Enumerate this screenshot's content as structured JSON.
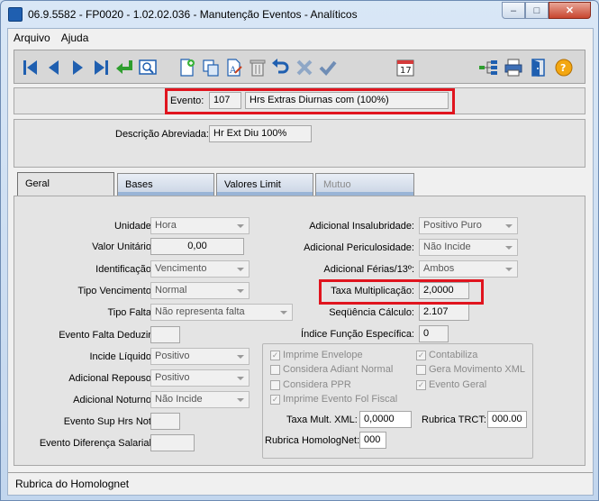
{
  "window": {
    "title": "06.9.5582 - FP0020 - 1.02.02.036 - Manutenção Eventos - Analíticos",
    "minimize": "–",
    "maximize": "□",
    "close": "✕"
  },
  "menu": {
    "items": [
      {
        "label": "Arquivo"
      },
      {
        "label": "Ajuda"
      }
    ]
  },
  "toolbar": {
    "icons": [
      "first-record-icon",
      "previous-record-icon",
      "next-record-icon",
      "last-record-icon",
      "return-icon",
      "search-icon",
      "new-document-icon",
      "copy-icon",
      "rename-icon",
      "delete-icon",
      "undo-icon",
      "cancel-icon",
      "confirm-icon",
      "calendar-icon",
      "tree-icon",
      "print-icon",
      "exit-door-icon",
      "help-icon"
    ],
    "calendar_day": "17",
    "help_label": "?"
  },
  "header": {
    "evento_label": "Evento:",
    "evento_code": "107",
    "evento_desc": "Hrs Extras Diurnas  com (100%)",
    "descricao_label": "Descrição Abreviada:",
    "descricao_value": "Hr Ext Diu 100%"
  },
  "tabs": [
    {
      "label": "Geral",
      "active": true
    },
    {
      "label": "Bases"
    },
    {
      "label": "Valores Limit"
    },
    {
      "label": "Mutuo",
      "disabled": true
    }
  ],
  "geral": {
    "left": {
      "unidade": {
        "label": "Unidade:",
        "value": "Hora"
      },
      "valor_unitario": {
        "label": "Valor Unitário:",
        "value": "0,00"
      },
      "identificacao": {
        "label": "Identificação:",
        "value": "Vencimento"
      },
      "tipo_vencimento": {
        "label": "Tipo Vencimento:",
        "value": "Normal"
      },
      "tipo_falta": {
        "label": "Tipo Falta:",
        "value": "Não representa falta"
      },
      "evento_falta": {
        "label": "Evento Falta Deduzir:",
        "value": ""
      },
      "incide_liquido": {
        "label": "Incide Líquido:",
        "value": "Positivo"
      },
      "adicional_repouso": {
        "label": "Adicional Repouso:",
        "value": "Positivo"
      },
      "adicional_noturno": {
        "label": "Adicional Noturno:",
        "value": "Não Incide"
      },
      "evento_sup": {
        "label": "Evento Sup Hrs Not:",
        "value": ""
      },
      "evento_diferenca": {
        "label": "Evento Diferença Salarial:",
        "value": ""
      }
    },
    "right": {
      "insalubridade": {
        "label": "Adicional Insalubridade:",
        "value": "Positivo Puro"
      },
      "periculosidade": {
        "label": "Adicional Periculosidade:",
        "value": "Não Incide"
      },
      "ferias": {
        "label": "Adicional Férias/13º:",
        "value": "Ambos"
      },
      "taxa_mult": {
        "label": "Taxa Multiplicação:",
        "value": "2,0000"
      },
      "sequencia": {
        "label": "Seqüência Cálculo:",
        "value": "2.107"
      },
      "indice": {
        "label": "Índice Função Específica:",
        "value": "0"
      }
    },
    "checks": {
      "imprime_envelope": {
        "label": "Imprime Envelope",
        "checked": true
      },
      "contabiliza": {
        "label": "Contabiliza",
        "checked": true
      },
      "considera_adiant": {
        "label": "Considera Adiant Normal",
        "checked": false
      },
      "gera_movimento": {
        "label": "Gera Movimento XML",
        "checked": false
      },
      "considera_ppr": {
        "label": "Considera PPR",
        "checked": false
      },
      "evento_geral": {
        "label": "Evento Geral",
        "checked": true
      },
      "imprime_fol": {
        "label": "Imprime Evento Fol Fiscal",
        "checked": true
      }
    },
    "group": {
      "taxa_xml_label": "Taxa Mult. XML:",
      "taxa_xml_value": "0,0000",
      "rubrica_trct_label": "Rubrica TRCT:",
      "rubrica_trct_value": "000.00",
      "rubrica_homolog_label": "Rubrica HomologNet:",
      "rubrica_homolog_value": "000"
    }
  },
  "status": {
    "text": "Rubrica do Homolognet"
  },
  "colors": {
    "highlight": "#e0141e",
    "toolbar_blue": "#1f5fb0"
  }
}
